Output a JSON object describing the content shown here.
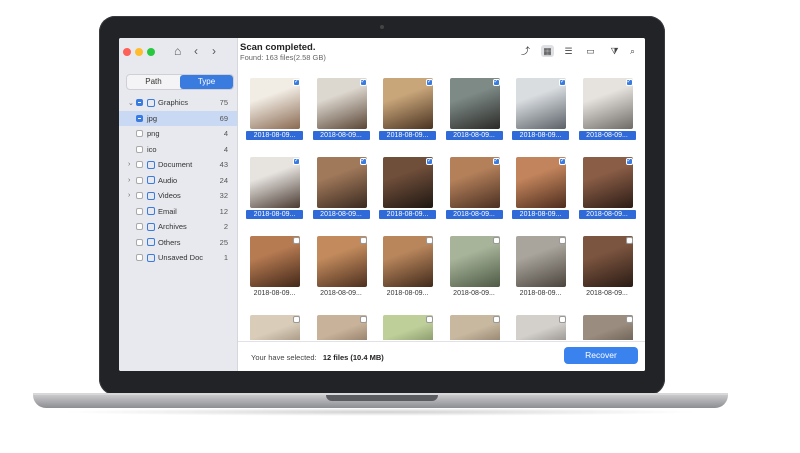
{
  "sidebar": {
    "nav": {
      "home": "⌂",
      "back": "‹",
      "forward": "›"
    },
    "tabs": [
      {
        "label": "Path",
        "active": false
      },
      {
        "label": "Type",
        "active": true
      }
    ],
    "tree": [
      {
        "label": "Graphics",
        "count": "75",
        "arrow": "⌄",
        "checked": true,
        "icon": "image-icon",
        "selected": false
      },
      {
        "label": "jpg",
        "count": "69",
        "arrow": "",
        "checked": true,
        "icon": "",
        "selected": true,
        "indent": true
      },
      {
        "label": "png",
        "count": "4",
        "arrow": "",
        "checked": false,
        "icon": "",
        "selected": false,
        "indent": true
      },
      {
        "label": "ico",
        "count": "4",
        "arrow": "",
        "checked": false,
        "icon": "",
        "selected": false,
        "indent": true
      },
      {
        "label": "Document",
        "count": "43",
        "arrow": "›",
        "checked": false,
        "icon": "document-icon",
        "selected": false
      },
      {
        "label": "Audio",
        "count": "24",
        "arrow": "›",
        "checked": false,
        "icon": "audio-icon",
        "selected": false
      },
      {
        "label": "Videos",
        "count": "32",
        "arrow": "›",
        "checked": false,
        "icon": "video-icon",
        "selected": false
      },
      {
        "label": "Email",
        "count": "12",
        "arrow": "",
        "checked": false,
        "icon": "email-icon",
        "selected": false
      },
      {
        "label": "Archives",
        "count": "2",
        "arrow": "",
        "checked": false,
        "icon": "archive-icon",
        "selected": false
      },
      {
        "label": "Others",
        "count": "25",
        "arrow": "",
        "checked": false,
        "icon": "others-icon",
        "selected": false
      },
      {
        "label": "Unsaved Doc",
        "count": "1",
        "arrow": "",
        "checked": false,
        "icon": "clock-icon",
        "selected": false
      }
    ]
  },
  "header": {
    "title": "Scan completed.",
    "subtitle": "Found: 163 files(2.58 GB)"
  },
  "toolbar": [
    "export-icon",
    "grid-view-icon",
    "list-view-icon",
    "preview-view-icon",
    "filter-icon",
    "search-icon"
  ],
  "files": [
    {
      "name": "2018-08-09...",
      "selected": true
    },
    {
      "name": "2018-08-09...",
      "selected": true
    },
    {
      "name": "2018-08-09...",
      "selected": true
    },
    {
      "name": "2018-08-09...",
      "selected": true
    },
    {
      "name": "2018-08-09...",
      "selected": true
    },
    {
      "name": "2018-08-09...",
      "selected": true
    },
    {
      "name": "2018-08-09...",
      "selected": true
    },
    {
      "name": "2018-08-09...",
      "selected": true
    },
    {
      "name": "2018-08-09...",
      "selected": true
    },
    {
      "name": "2018-08-09...",
      "selected": true
    },
    {
      "name": "2018-08-09...",
      "selected": true
    },
    {
      "name": "2018-08-09...",
      "selected": true
    },
    {
      "name": "2018-08-09...",
      "selected": false
    },
    {
      "name": "2018-08-09...",
      "selected": false
    },
    {
      "name": "2018-08-09...",
      "selected": false
    },
    {
      "name": "2018-08-09...",
      "selected": false
    },
    {
      "name": "2018-08-09...",
      "selected": false
    },
    {
      "name": "2018-08-09...",
      "selected": false
    },
    {
      "name": "",
      "selected": false
    },
    {
      "name": "",
      "selected": false
    },
    {
      "name": "",
      "selected": false
    },
    {
      "name": "",
      "selected": false
    },
    {
      "name": "",
      "selected": false
    },
    {
      "name": "",
      "selected": false
    }
  ],
  "footer": {
    "selected_prefix": "Your have selected:",
    "selected_value": "12 files (10.4 MB)",
    "recover_label": "Recover"
  },
  "colors": {
    "accent": "#3a7be0",
    "selected_caption": "#2f6ad8",
    "recover": "#3a82ee"
  }
}
